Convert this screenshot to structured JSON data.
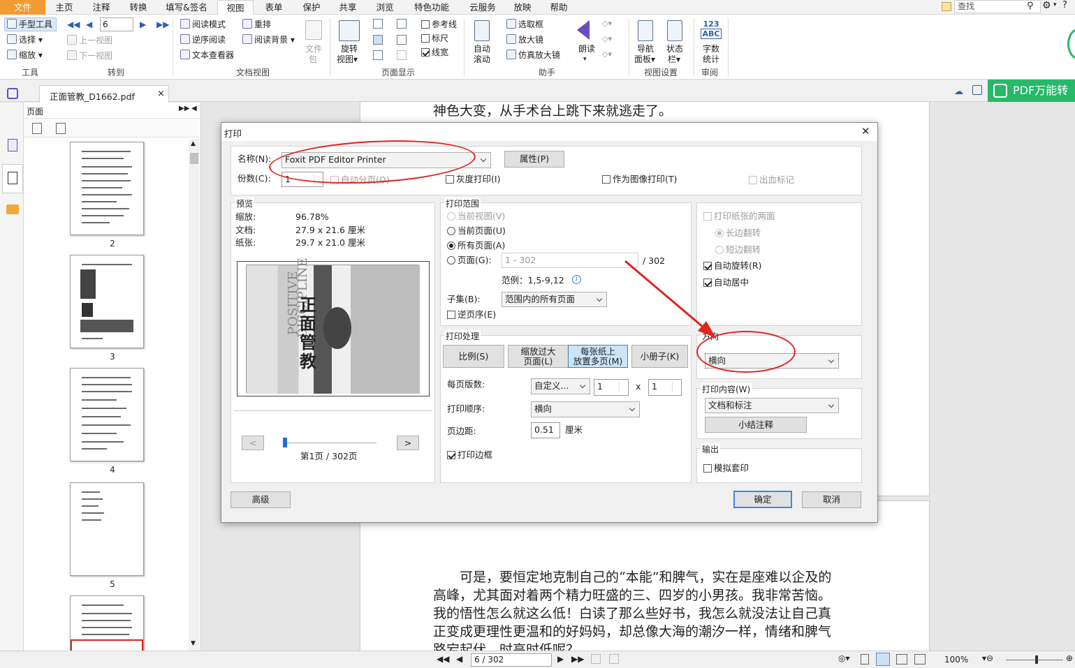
{
  "menu": {
    "file": "文件",
    "items": [
      "主页",
      "注释",
      "转换",
      "填写&签名",
      "视图",
      "表单",
      "保护",
      "共享",
      "浏览",
      "特色功能",
      "云服务",
      "放映",
      "帮助"
    ],
    "search_placeholder": "查找"
  },
  "ribbon": {
    "tools": {
      "hand": "手型工具",
      "select": "选择",
      "zoom": "缩放",
      "group": "工具"
    },
    "goto": {
      "page_value": "6",
      "prev_view": "上一视图",
      "next_view": "下一视图",
      "group": "转到"
    },
    "docview": {
      "reading_mode": "阅读模式",
      "reverse_reading": "逆序阅读",
      "text_viewer": "文本查看器",
      "reflow": "重排",
      "reading_bg": "阅读背景",
      "file_pkg_1": "文件",
      "file_pkg_2": "包",
      "group": "文档视图"
    },
    "pagedisplay": {
      "rotate_1": "旋转",
      "rotate_2": "视图",
      "guides": "参考线",
      "ruler": "标尺",
      "linewidth": "线宽",
      "group": "页面显示"
    },
    "assist": {
      "auto_1": "自动",
      "auto_2": "滚动",
      "marquee": "选取框",
      "magnifier": "放大镜",
      "loupe": "仿真放大镜",
      "read": "朗读",
      "group": "助手"
    },
    "viewset": {
      "nav_1": "导航",
      "nav_2": "面板",
      "status_1": "状态",
      "status_2": "栏",
      "group": "视图设置"
    },
    "review": {
      "icon_top": "123",
      "icon_bottom": "ABC",
      "wc_1": "字数",
      "wc_2": "统计",
      "group": "审阅"
    }
  },
  "tab": {
    "filename": "正面管教_D1662.pdf",
    "close": "×"
  },
  "promo": "PDF万能转",
  "panel": {
    "title": "页面",
    "pages": [
      "2",
      "3",
      "4",
      "5"
    ]
  },
  "doc": {
    "line_top": "神色大变，从手术台上跳下来就逃走了。",
    "para": [
      "可是，要恒定地克制自己的“本能”和脾气，实在是座难以企及的",
      "高峰，尤其面对着两个精力旺盛的三、四岁的小男孩。我非常苦恼。",
      "我的悟性怎么就这么低！白读了那么些好书，我怎么就没法让自己真",
      "正变成更理性更温和的好妈妈，却总像大海的潮汐一样，情绪和脾气",
      "路宕起伏，时高时低呢？"
    ]
  },
  "status": {
    "page_field": "6 / 302",
    "zoom": "100%"
  },
  "dialog": {
    "title": "打印",
    "close": "✕",
    "printer_label": "名称(N):",
    "printer_value": "Foxit PDF Editor Printer",
    "properties": "属性(P)",
    "copies_label": "份数(C):",
    "copies_value": "1",
    "collate": "自动分页(O)",
    "grayscale": "灰度打印(I)",
    "as_image": "作为图像打印(T)",
    "bleed": "出血标记",
    "preview": {
      "legend": "预览",
      "zoom_label": "缩放:",
      "zoom_value": "96.78%",
      "doc_label": "文档:",
      "doc_value": "27.9 x 21.6 厘米",
      "paper_label": "纸张:",
      "paper_value": "29.7 x 21.0 厘米",
      "page_info": "第1页 / 302页",
      "prev": "<",
      "next": ">",
      "cover_title": "正面管教",
      "cover_en_1": "POSITIVE",
      "cover_en_2": "DISCIPLINE"
    },
    "range": {
      "legend": "打印范围",
      "current_view": "当前视图(V)",
      "current_page": "当前页面(U)",
      "all_pages": "所有页面(A)",
      "pages": "页面(G):",
      "pages_value": "1 - 302",
      "pages_total": "/ 302",
      "example": "范例：1,5-9,12",
      "subset_label": "子集(B):",
      "subset_value": "范围内的所有页面",
      "reverse": "逆页序(E)"
    },
    "handling": {
      "legend": "打印处理",
      "scale": "比例(S)",
      "shrink_1": "缩放过大",
      "shrink_2": "页面(L)",
      "multi_1": "每张纸上",
      "multi_2": "放置多页(M)",
      "booklet": "小册子(K)",
      "pps_label": "每页版数:",
      "pps_value": "自定义...",
      "cols": "1",
      "x": "x",
      "rows": "1",
      "order_label": "打印顺序:",
      "order_value": "横向",
      "margin_label": "页边距:",
      "margin_value": "0.51",
      "margin_unit": "厘米",
      "border": "打印边框"
    },
    "duplex": {
      "both_sides": "打印纸张的两面",
      "long_edge": "长边翻转",
      "short_edge": "短边翻转",
      "auto_rotate": "自动旋转(R)",
      "auto_center": "自动居中"
    },
    "orientation": {
      "legend": "方向",
      "value": "横向"
    },
    "content": {
      "legend": "打印内容(W)",
      "value": "文档和标注",
      "summarize": "小结注释"
    },
    "output": {
      "legend": "输出",
      "simulate": "模拟套印"
    },
    "advanced": "高级",
    "ok": "确定",
    "cancel": "取消"
  },
  "colors": {
    "accent_orange": "#f29a33",
    "promo_green": "#27b86a",
    "annotation_red": "#e0241f"
  }
}
